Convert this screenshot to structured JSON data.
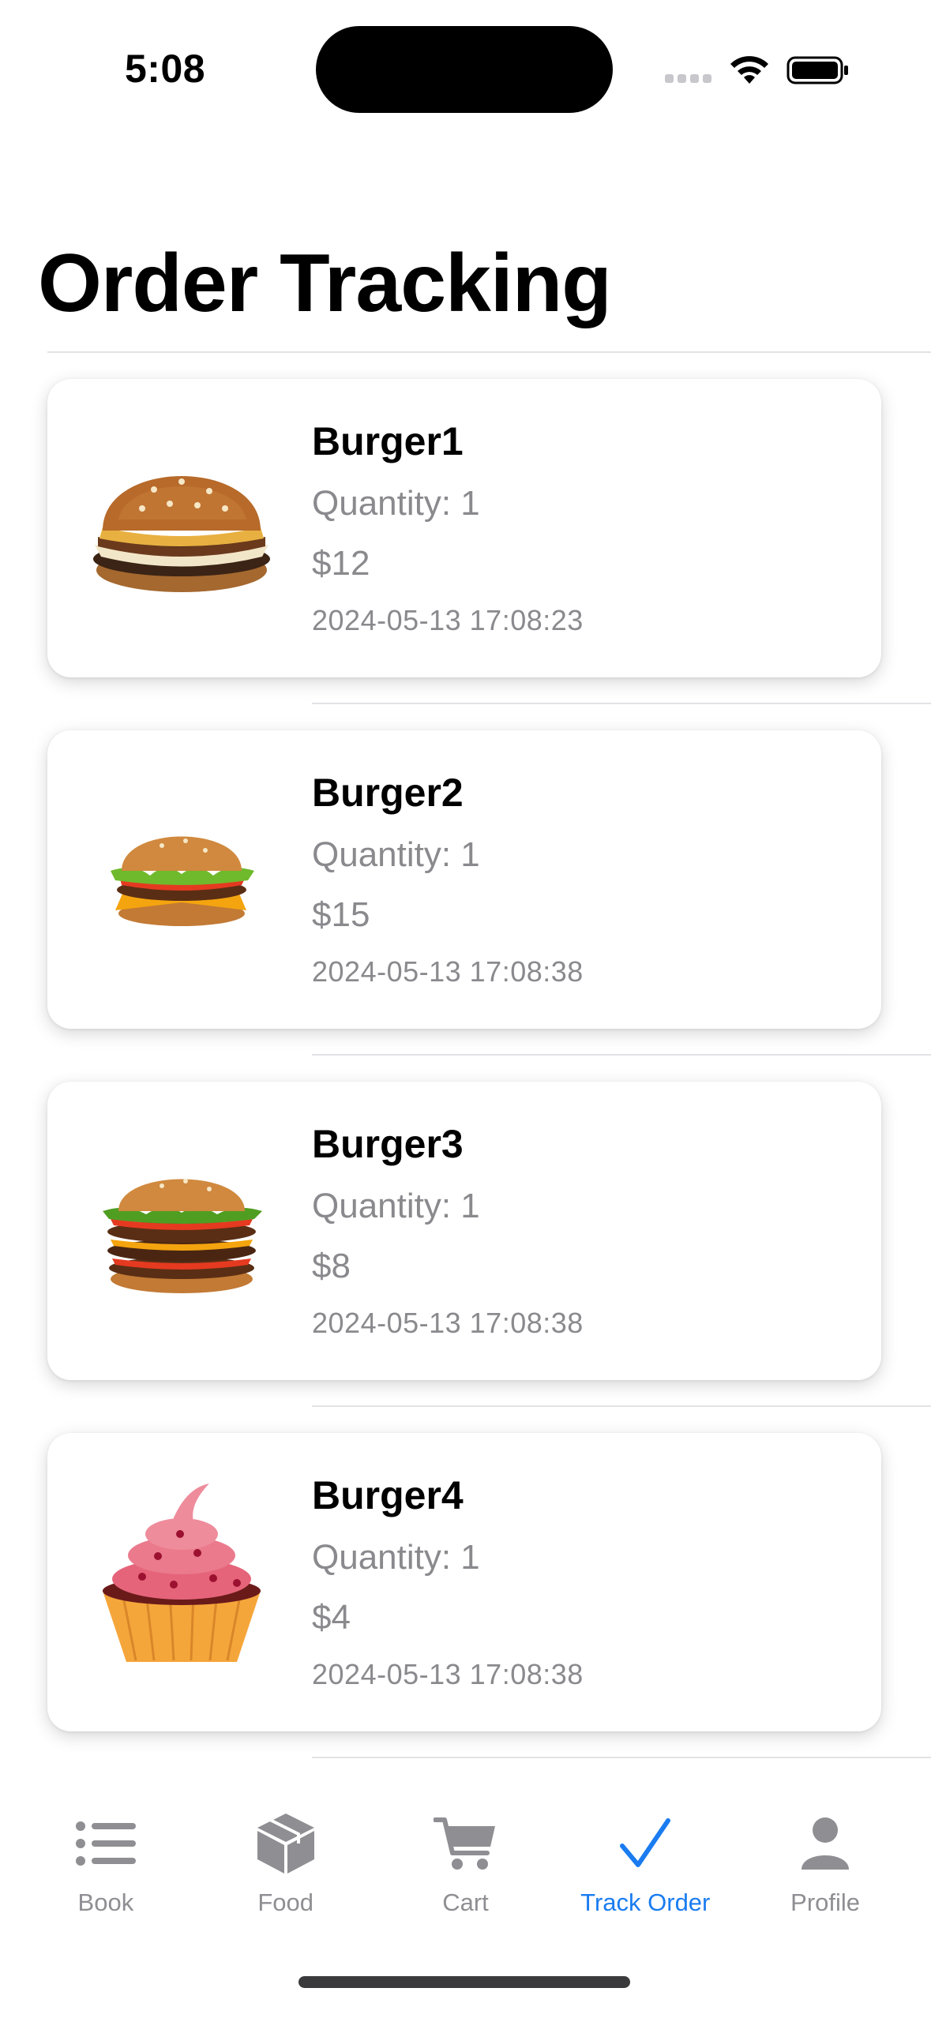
{
  "status_bar": {
    "time": "5:08"
  },
  "page": {
    "title": "Order Tracking"
  },
  "orders": [
    {
      "name": "Burger1",
      "quantity": "Quantity: 1",
      "price": "$12",
      "date": "2024-05-13 17:08:23",
      "image": "burger-image"
    },
    {
      "name": "Burger2",
      "quantity": "Quantity: 1",
      "price": "$15",
      "date": "2024-05-13 17:08:38",
      "image": "cheeseburger-image"
    },
    {
      "name": "Burger3",
      "quantity": "Quantity: 1",
      "price": "$8",
      "date": "2024-05-13 17:08:38",
      "image": "double-burger-image"
    },
    {
      "name": "Burger4",
      "quantity": "Quantity: 1",
      "price": "$4",
      "date": "2024-05-13 17:08:38",
      "image": "cupcake-image"
    }
  ],
  "tab_bar": {
    "tabs": [
      {
        "label": "Book",
        "icon": "list-icon"
      },
      {
        "label": "Food",
        "icon": "box-icon"
      },
      {
        "label": "Cart",
        "icon": "cart-icon"
      },
      {
        "label": "Track Order",
        "icon": "checkmark-icon"
      },
      {
        "label": "Profile",
        "icon": "person-icon"
      }
    ]
  },
  "colors": {
    "accent": "#1a7cf0",
    "inactive": "#8e8e93",
    "secondary_text": "#8a8a8e"
  }
}
